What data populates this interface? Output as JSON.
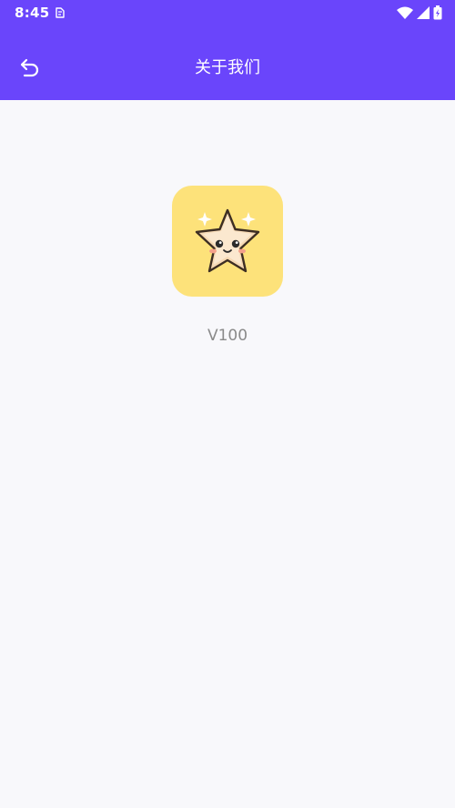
{
  "status_bar": {
    "time": "8:45",
    "icons": [
      "notification-icon",
      "wifi-icon",
      "signal-icon",
      "battery-icon"
    ]
  },
  "header": {
    "title": "关于我们",
    "back_icon": "back-arrow-icon"
  },
  "about": {
    "app_icon": "star-mascot-icon",
    "version": "V100"
  },
  "colors": {
    "primary": "#6a45fb",
    "background": "#f8f8fb",
    "icon_background": "#fde27a",
    "version_text": "#8a8a8a"
  }
}
